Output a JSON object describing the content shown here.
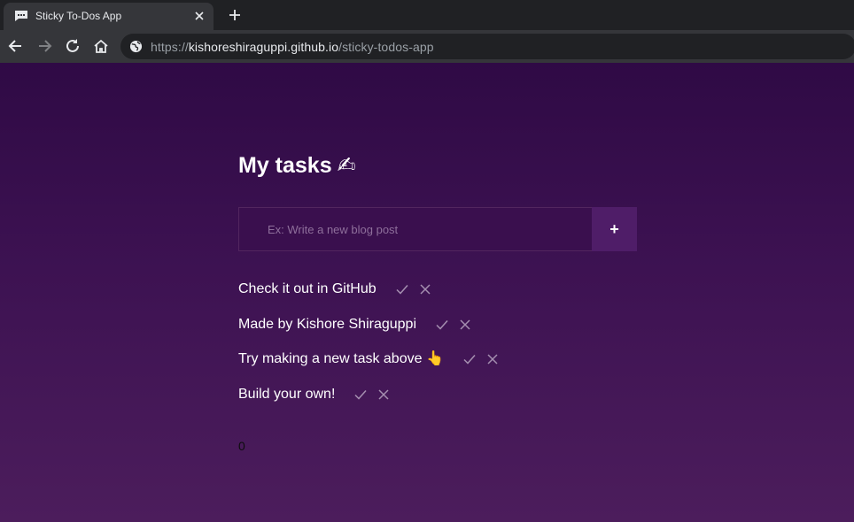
{
  "browser": {
    "tab_title": "Sticky To-Dos App",
    "url_scheme": "https://",
    "url_host": "kishoreshiraguppi.github.io",
    "url_path": "/sticky-todos-app",
    "icons": {
      "favicon": "chat-bubble-icon",
      "tab_close": "close-icon",
      "new_tab": "plus-icon",
      "back": "arrow-left-icon",
      "forward": "arrow-right-icon",
      "reload": "reload-icon",
      "home": "home-icon",
      "site_info": "globe-icon"
    }
  },
  "app": {
    "title": "My tasks",
    "title_emoji": "✍",
    "input_placeholder": "Ex: Write a new blog post",
    "input_value": "",
    "add_button_label": "+",
    "tasks": [
      {
        "text": "Check it out in GitHub",
        "emoji": ""
      },
      {
        "text": "Made by Kishore Shiraguppi",
        "emoji": ""
      },
      {
        "text": "Try making a new task above ",
        "emoji": "👆"
      },
      {
        "text": "Build your own!",
        "emoji": ""
      }
    ],
    "task_icons": {
      "complete": "check-icon",
      "remove": "close-icon"
    },
    "count": "0"
  },
  "colors": {
    "background_top": "#2f0a45",
    "background_bottom": "#4c1d5c",
    "accent": "#4f1d68",
    "text": "#ffffff",
    "icon": "#a58fb0"
  }
}
